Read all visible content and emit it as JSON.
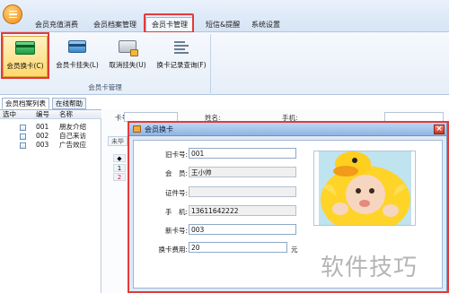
{
  "ribbon": {
    "tabs": [
      {
        "label": "会员充值消费"
      },
      {
        "label": "会员档案管理"
      },
      {
        "label": "会员卡管理"
      },
      {
        "label": "短信&提醒"
      },
      {
        "label": "系统设置"
      }
    ],
    "active_tab": "会员卡管理",
    "buttons": [
      {
        "label": "会员换卡(C)",
        "icon": "card-swap-icon"
      },
      {
        "label": "会员卡挂失(L)",
        "icon": "card-lost-icon"
      },
      {
        "label": "取消挂失(U)",
        "icon": "cancel-lost-icon"
      },
      {
        "label": "换卡记录查询(F)",
        "icon": "records-icon"
      }
    ],
    "group_label": "会员卡管理"
  },
  "left_panel": {
    "tabs": [
      {
        "label": "会员档案列表"
      },
      {
        "label": "在线帮助"
      }
    ],
    "columns": [
      "选中",
      "编号",
      "名称"
    ],
    "rows": [
      {
        "code": "001",
        "name": "朋友介绍"
      },
      {
        "code": "002",
        "name": "自己来访"
      },
      {
        "code": "003",
        "name": "广告效应"
      }
    ]
  },
  "background_view": {
    "labels": [
      "卡号:",
      "姓名:",
      "手机:"
    ],
    "button": "未毕",
    "row_numbers": [
      "1",
      "2"
    ],
    "small_mark": "◆"
  },
  "dialog": {
    "title": "会员换卡",
    "close_symbol": "×",
    "fields": {
      "old_card_label": "旧卡号:",
      "old_card_value": "001",
      "member_label": "会　员:",
      "member_value": "王小帅",
      "id_label": "证件号:",
      "id_value": "",
      "phone_label": "手　机:",
      "phone_value": "13611642222",
      "new_card_label": "新卡号:",
      "new_card_value": "003",
      "fee_label": "换卡费用:",
      "fee_value": "20",
      "fee_unit": "元"
    }
  },
  "watermark": {
    "text": "软件技巧"
  },
  "colors": {
    "highlight": "#e23b3b",
    "ribbon": "#d6e4f5",
    "dialog_bg": "#dfe9f5"
  }
}
